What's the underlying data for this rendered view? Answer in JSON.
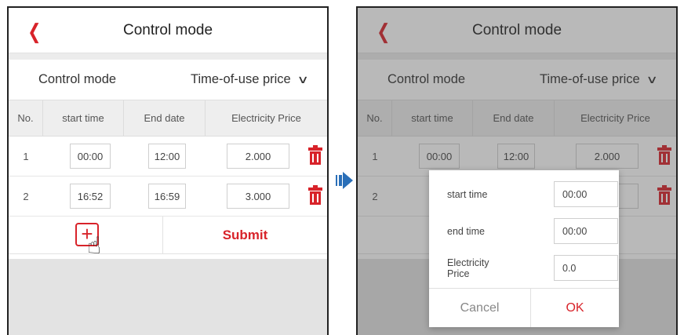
{
  "header": {
    "title": "Control mode",
    "back_icon": "chevron-left-icon"
  },
  "mode": {
    "label": "Control mode",
    "value": "Time-of-use price"
  },
  "table": {
    "columns": [
      "No.",
      "start time",
      "End date",
      "Electricity Price"
    ],
    "rows": [
      {
        "no": "1",
        "start": "00:00",
        "end": "12:00",
        "price": "2.000"
      },
      {
        "no": "2",
        "start": "16:52",
        "end": "16:59",
        "price": "3.000"
      }
    ]
  },
  "right_rows": [
    {
      "no": "1",
      "start": "00:00",
      "end": "12:00",
      "price": "2.000"
    },
    {
      "no": "2"
    }
  ],
  "actions": {
    "add_symbol": "+",
    "submit_label": "Submit"
  },
  "dialog": {
    "start_label": "start time",
    "start_value": "00:00",
    "end_label": "end time",
    "end_value": "00:00",
    "price_label": "Electricity Price",
    "price_value": "0.0",
    "cancel_label": "Cancel",
    "ok_label": "OK"
  },
  "colors": {
    "accent": "#d8232a",
    "arrow": "#2a6fb8"
  }
}
